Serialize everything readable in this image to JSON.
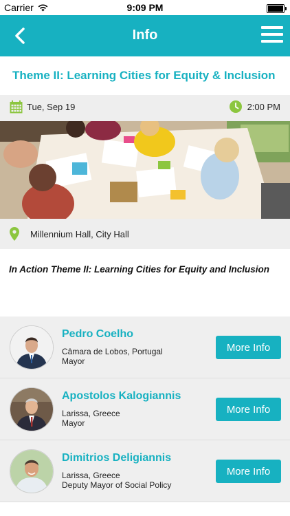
{
  "status": {
    "carrier": "Carrier",
    "time": "9:09 PM"
  },
  "nav": {
    "title": "Info"
  },
  "event": {
    "title": "Theme II: Learning Cities for Equity & Inclusion",
    "date": "Tue, Sep 19",
    "time": "2:00 PM",
    "location": "Millennium Hall, City Hall",
    "description": "In Action Theme II: Learning Cities for Equity and Inclusion"
  },
  "speakers": [
    {
      "name": "Pedro Coelho",
      "location": "Câmara de Lobos, Portugal",
      "role": "Mayor",
      "button": "More Info"
    },
    {
      "name": "Apostolos Kalogiannis",
      "location": "Larissa, Greece",
      "role": "Mayor",
      "button": "More Info"
    },
    {
      "name": "Dimitrios Deligiannis",
      "location": "Larissa, Greece",
      "role": "Deputy Mayor of Social Policy",
      "button": "More Info"
    }
  ],
  "colors": {
    "accent": "#17b1c1",
    "icon_green": "#8cc63f",
    "row_gray": "#eeeeee"
  }
}
